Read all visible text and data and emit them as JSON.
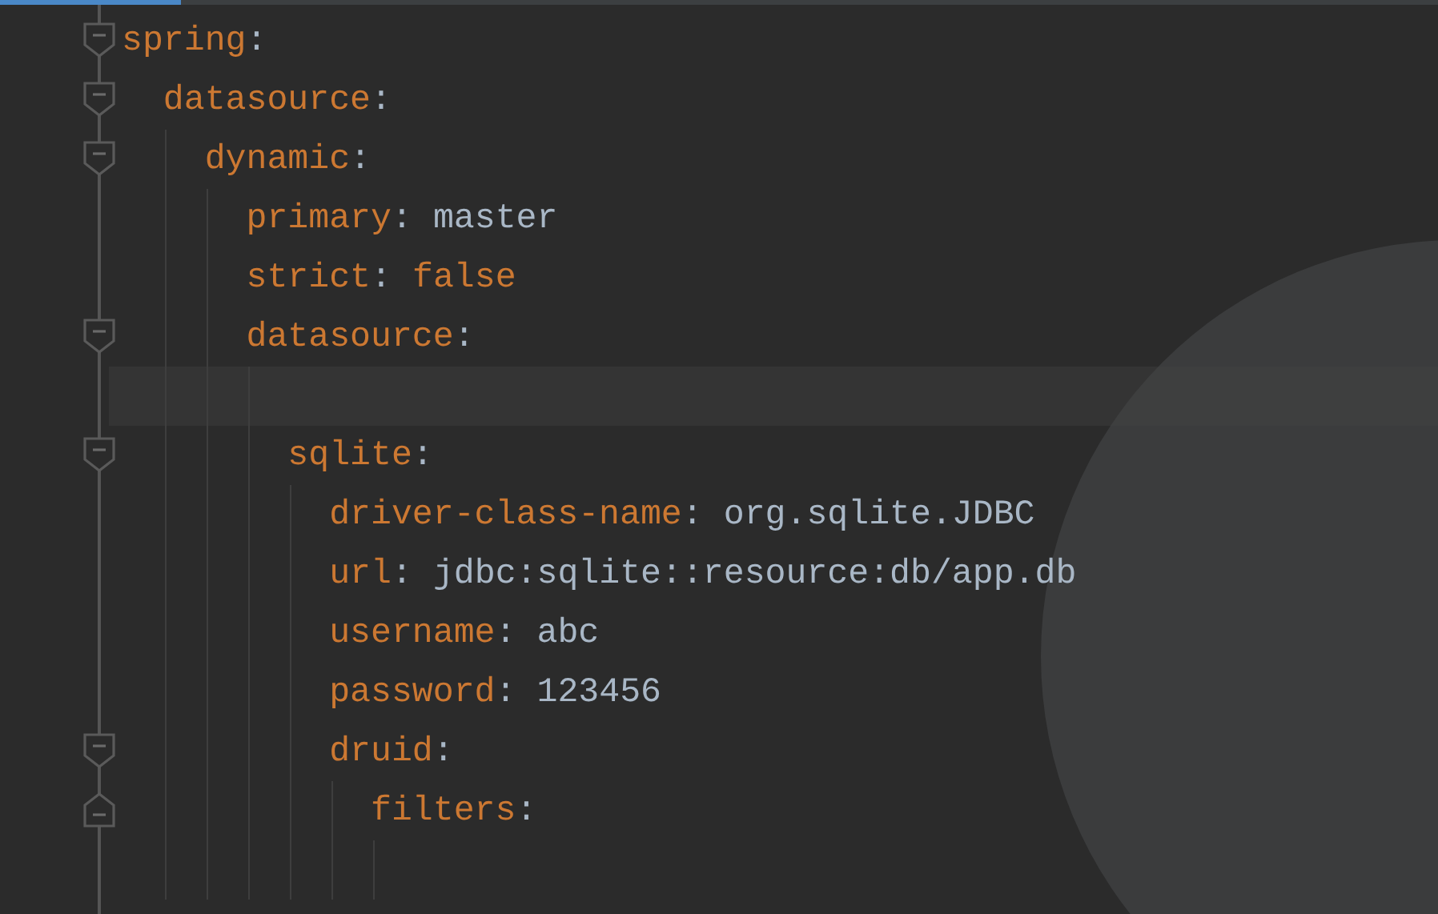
{
  "editor": {
    "lines": [
      {
        "key": "spring:",
        "fold_start": true,
        "children": [
          {
            "key": "datasource:",
            "fold_start": true,
            "children": [
              {
                "key": "dynamic:",
                "fold_start": true,
                "children": [
                  {
                    "key": "primary:",
                    "value": "master",
                    "keyword": false
                  },
                  {
                    "key": "strict:",
                    "value": "false",
                    "keyword": true
                  },
                  {
                    "key": "datasource:",
                    "fold_start": true,
                    "children": [
                      {
                        "kind": "blank",
                        "current": true
                      },
                      {
                        "key": "sqlite:",
                        "fold_start": true,
                        "children": [
                          {
                            "key": "driver-class-name:",
                            "value": "org.sqlite.JDBC",
                            "keyword": false
                          },
                          {
                            "key": "url:",
                            "value": "jdbc:sqlite::resource:db/app.db",
                            "keyword": false
                          },
                          {
                            "key": "username:",
                            "value": "abc",
                            "keyword": false
                          },
                          {
                            "key": "password:",
                            "value": "123456",
                            "keyword": false
                          },
                          {
                            "key": "druid:",
                            "fold_start": true,
                            "children": [
                              {
                                "key": "filters:",
                                "fold_end": true,
                                "children": [
                                  {
                                    "kind": "blank",
                                    "current": false
                                  }
                                ]
                              }
                            ]
                          }
                        ]
                      }
                    ]
                  }
                ]
              }
            ]
          }
        ]
      }
    ]
  }
}
